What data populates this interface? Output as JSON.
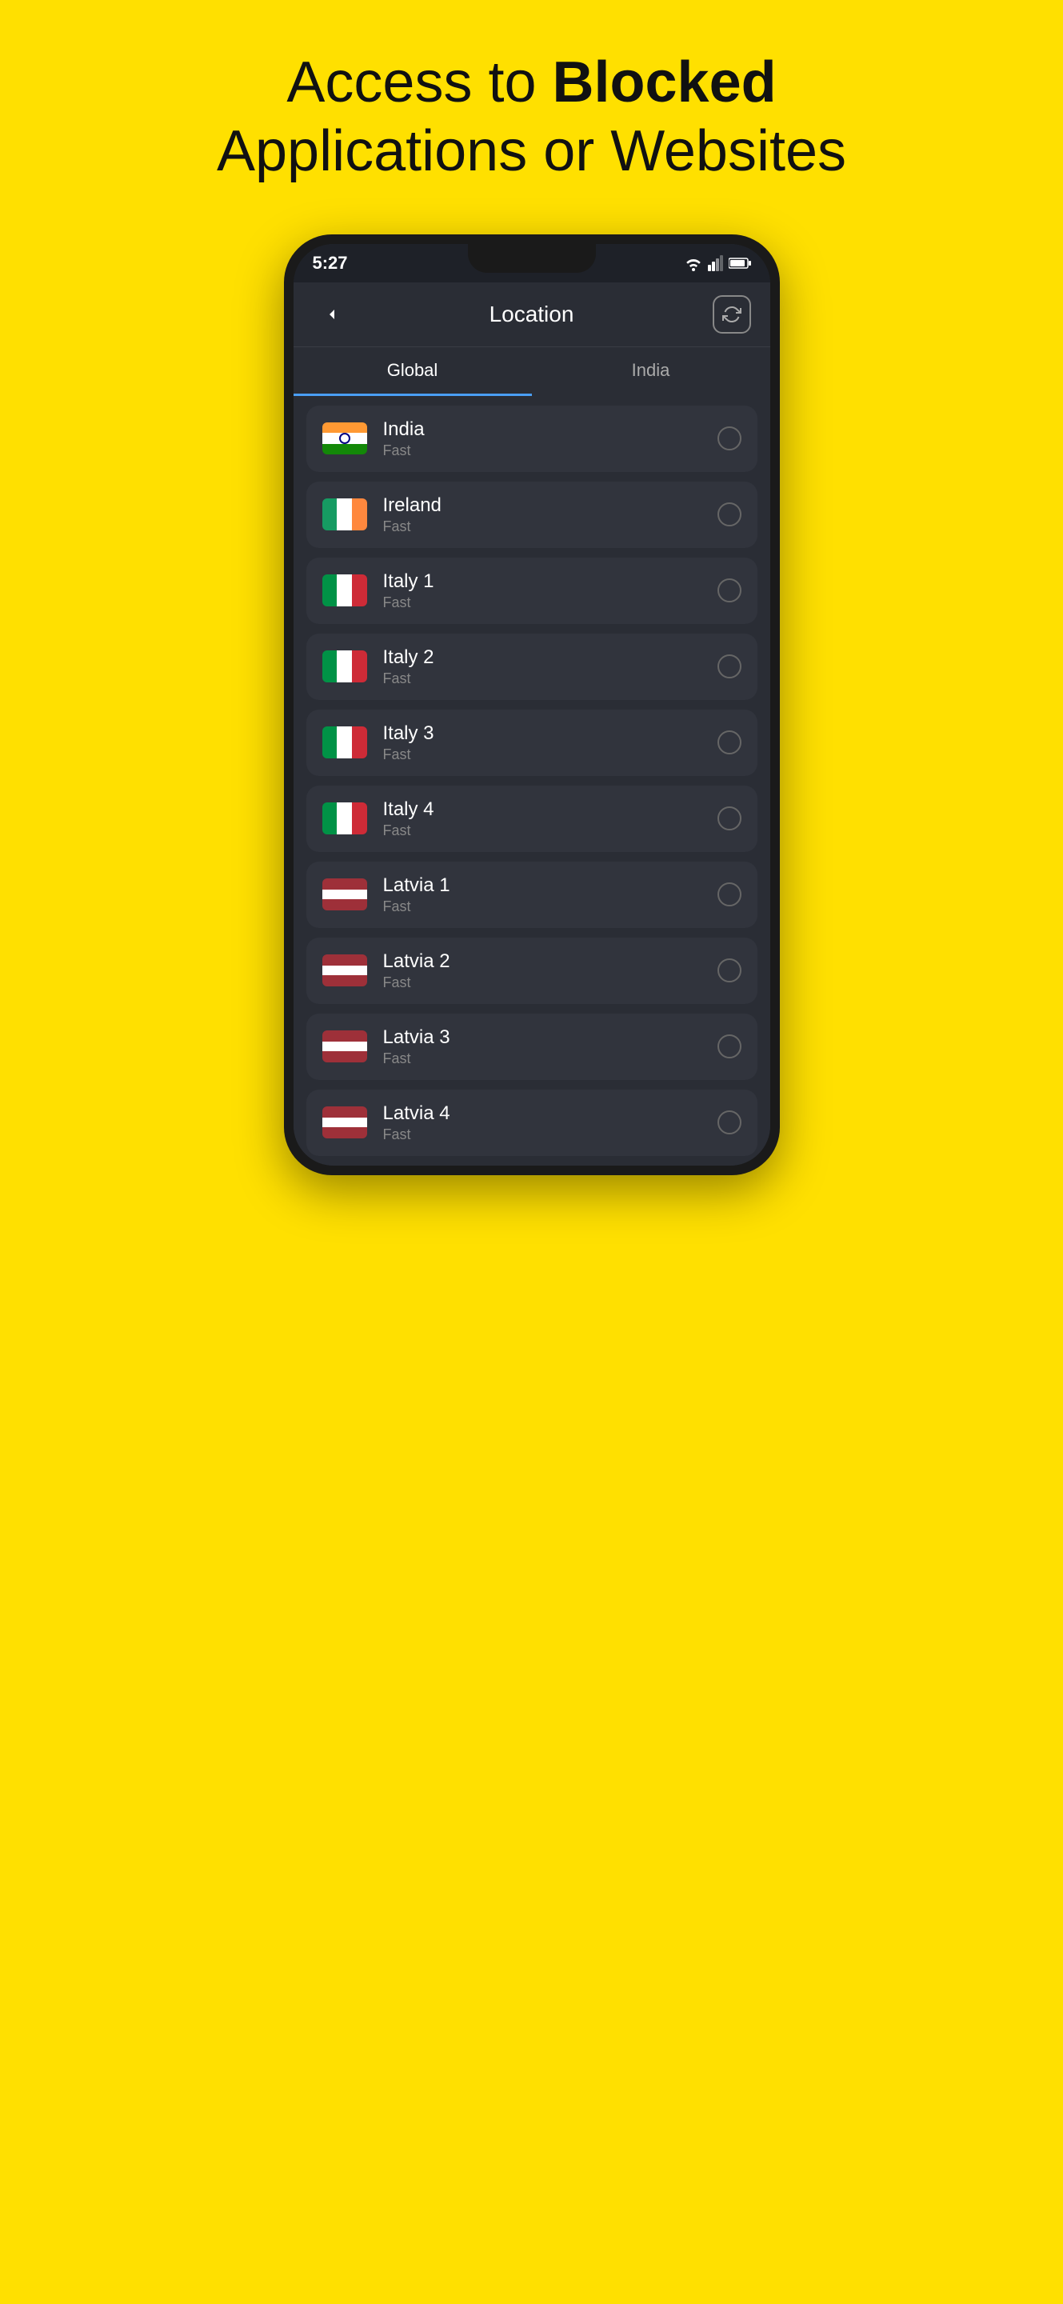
{
  "hero": {
    "line1": "Access to ",
    "bold": "Blocked",
    "line2": "Applications or Websites"
  },
  "status_bar": {
    "time": "5:27"
  },
  "header": {
    "title": "Location",
    "back_label": "back",
    "refresh_label": "refresh"
  },
  "tabs": [
    {
      "id": "global",
      "label": "Global",
      "active": true
    },
    {
      "id": "india",
      "label": "India",
      "active": false
    }
  ],
  "locations": [
    {
      "id": "india",
      "name": "India",
      "speed": "Fast",
      "flag": "india",
      "selected": false
    },
    {
      "id": "ireland",
      "name": "Ireland",
      "speed": "Fast",
      "flag": "ireland",
      "selected": false
    },
    {
      "id": "italy1",
      "name": "Italy 1",
      "speed": "Fast",
      "flag": "italy",
      "selected": false
    },
    {
      "id": "italy2",
      "name": "Italy 2",
      "speed": "Fast",
      "flag": "italy",
      "selected": false
    },
    {
      "id": "italy3",
      "name": "Italy 3",
      "speed": "Fast",
      "flag": "italy",
      "selected": false
    },
    {
      "id": "italy4",
      "name": "Italy 4",
      "speed": "Fast",
      "flag": "italy",
      "selected": false
    },
    {
      "id": "latvia1",
      "name": "Latvia 1",
      "speed": "Fast",
      "flag": "latvia",
      "selected": false
    },
    {
      "id": "latvia2",
      "name": "Latvia 2",
      "speed": "Fast",
      "flag": "latvia",
      "selected": false
    },
    {
      "id": "latvia3",
      "name": "Latvia 3",
      "speed": "Fast",
      "flag": "latvia",
      "selected": false
    },
    {
      "id": "latvia4",
      "name": "Latvia 4",
      "speed": "Fast",
      "flag": "latvia",
      "selected": false
    }
  ]
}
